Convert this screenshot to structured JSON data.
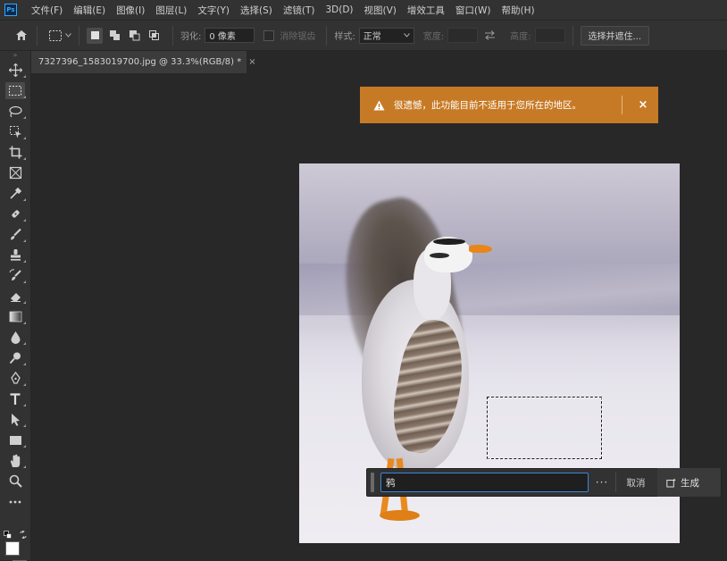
{
  "app": {
    "logo": "Ps"
  },
  "menu": [
    "文件(F)",
    "编辑(E)",
    "图像(I)",
    "图层(L)",
    "文字(Y)",
    "选择(S)",
    "滤镜(T)",
    "3D(D)",
    "视图(V)",
    "增效工具",
    "窗口(W)",
    "帮助(H)"
  ],
  "options": {
    "feather_label": "羽化:",
    "feather_value": "0 像素",
    "antialias_label": "消除锯齿",
    "style_label": "样式:",
    "style_value": "正常",
    "width_label": "宽度:",
    "height_label": "高度:",
    "select_mask_label": "选择并遮住..."
  },
  "document": {
    "tab_title": "7327396_1583019700.jpg @ 33.3%(RGB/8) *",
    "close_glyph": "×"
  },
  "notice": {
    "message": "很遗憾，此功能目前不适用于您所在的地区。",
    "close_glyph": "×"
  },
  "context_bar": {
    "prompt_value": "鸦",
    "more_glyph": "···",
    "cancel_label": "取消",
    "generate_label": "生成"
  },
  "colors": {
    "accent": "#3d86d6",
    "notice_bg": "#c77a25",
    "ps_blue": "#31a8ff"
  },
  "tools": [
    "move-icon",
    "rect-marquee-icon",
    "lasso-icon",
    "object-select-icon",
    "crop-icon",
    "frame-icon",
    "eyedropper-icon",
    "healing-brush-icon",
    "brush-icon",
    "clone-stamp-icon",
    "history-brush-icon",
    "eraser-icon",
    "gradient-icon",
    "blur-icon",
    "dodge-icon",
    "pen-icon",
    "type-icon",
    "path-select-icon",
    "rectangle-shape-icon",
    "hand-icon",
    "zoom-icon",
    "more-tools-icon"
  ]
}
